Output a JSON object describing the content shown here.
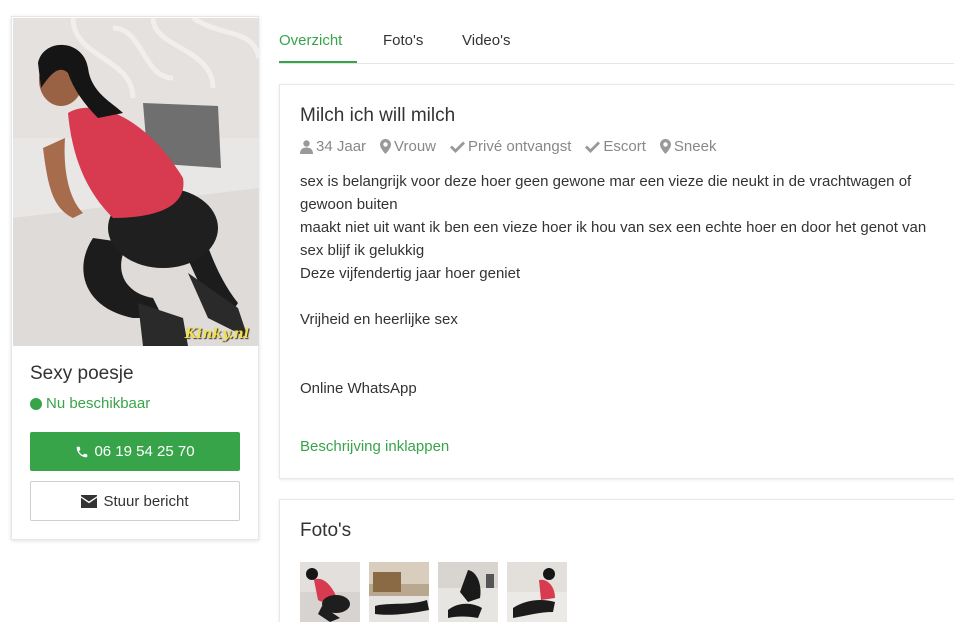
{
  "profile": {
    "name": "Sexy poesje",
    "status": "Nu beschikbaar",
    "phone": "06 19 54 25 70",
    "message_label": "Stuur bericht",
    "watermark": "Kinky.nl"
  },
  "tabs": [
    "Overzicht",
    "Foto's",
    "Video's"
  ],
  "active_tab": "Overzicht",
  "description": {
    "title": "Milch ich will milch",
    "meta": {
      "age": "34 Jaar",
      "gender": "Vrouw",
      "reception": "Privé ontvangst",
      "escort": "Escort",
      "city": "Sneek"
    },
    "lines": [
      "sex is belangrijk voor deze hoer geen gewone mar een vieze die neukt in de vrachtwagen of gewoon buiten",
      "maakt niet uit want ik ben een vieze hoer ik hou van sex een echte hoer en door het genot van sex blijf ik gelukkig",
      "Deze vijfendertig jaar hoer geniet",
      "Vrijheid en heerlijke sex",
      "Online WhatsApp"
    ],
    "collapse_label": "Beschrijving inklappen"
  },
  "photos": {
    "title": "Foto's"
  },
  "colors": {
    "accent": "#38a44a",
    "text": "#333333",
    "muted": "#888888"
  }
}
